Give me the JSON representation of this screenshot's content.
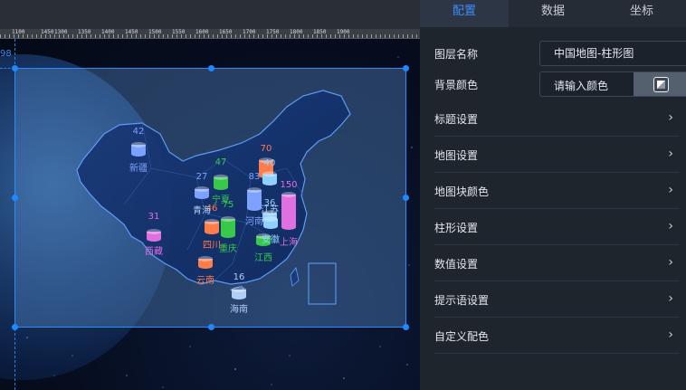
{
  "ruler": {
    "labels": [
      "1100",
      "1450",
      "1300",
      "1350",
      "1400",
      "1450",
      "1500",
      "1550",
      "1600",
      "1650",
      "1700",
      "1750",
      "1800",
      "1850",
      "1900"
    ]
  },
  "canvas": {
    "side_number": "98"
  },
  "map": {
    "bars": [
      {
        "value": "42",
        "color": "#7da1ff",
        "province": "新疆",
        "province_color": "#7da1ff"
      },
      {
        "value": "27",
        "color": "#7da1ff",
        "province": "青海",
        "province_color": "#b0cdf5"
      },
      {
        "value": "47",
        "color": "#38c94a",
        "province": "宁夏",
        "province_color": "#38c94a"
      },
      {
        "value": "70",
        "color": "#ff7d4a",
        "province": "",
        "province_color": "#ff7d4a"
      },
      {
        "value": "40",
        "color": "#8fd0ff",
        "province": "",
        "province_color": "#8fd0ff"
      },
      {
        "value": "83",
        "color": "#7da1ff",
        "province": "河南",
        "province_color": "#7da1ff"
      },
      {
        "value": "150",
        "color": "#e06fe0",
        "province": "上海",
        "province_color": "#e06fe0"
      },
      {
        "value": "36",
        "color": "#8fd0ff",
        "province": "江苏",
        "province_color": "#b0cdf5"
      },
      {
        "value": "31",
        "color": "#e06fe0",
        "province": "西藏",
        "province_color": "#e06fe0"
      },
      {
        "value": "46",
        "color": "#ff7d4a",
        "province": "四川",
        "province_color": "#ff7d4a"
      },
      {
        "value": "75",
        "color": "#38c94a",
        "province": "重庆",
        "province_color": "#38c94a"
      },
      {
        "value": "",
        "color": "#38c94a",
        "province": "江西",
        "province_color": "#38c94a"
      },
      {
        "value": "",
        "color": "#8fd0ff",
        "province": "安徽",
        "province_color": "#8fd0ff"
      },
      {
        "value": "",
        "color": "#ff7d4a",
        "province": "云南",
        "province_color": "#ff7d4a"
      },
      {
        "value": "16",
        "color": "#b0cdf5",
        "province": "海南",
        "province_color": "#b0cdf5"
      }
    ]
  },
  "panel": {
    "tabs": [
      "配置",
      "数据",
      "坐标"
    ],
    "active_tab": "配置",
    "layer_name_label": "图层名称",
    "layer_name_value": "中国地图-柱形图",
    "bg_color_label": "背景颜色",
    "bg_color_placeholder": "请输入颜色",
    "sections": [
      "标题设置",
      "地图设置",
      "地图块颜色",
      "柱形设置",
      "数值设置",
      "提示语设置",
      "自定义配色"
    ]
  },
  "colors": {
    "accent": "#3b8cff",
    "selection": "#2a8cff"
  },
  "icons": {
    "chevron": "chevron-right-icon",
    "color_swatch": "color-swatch-icon"
  }
}
